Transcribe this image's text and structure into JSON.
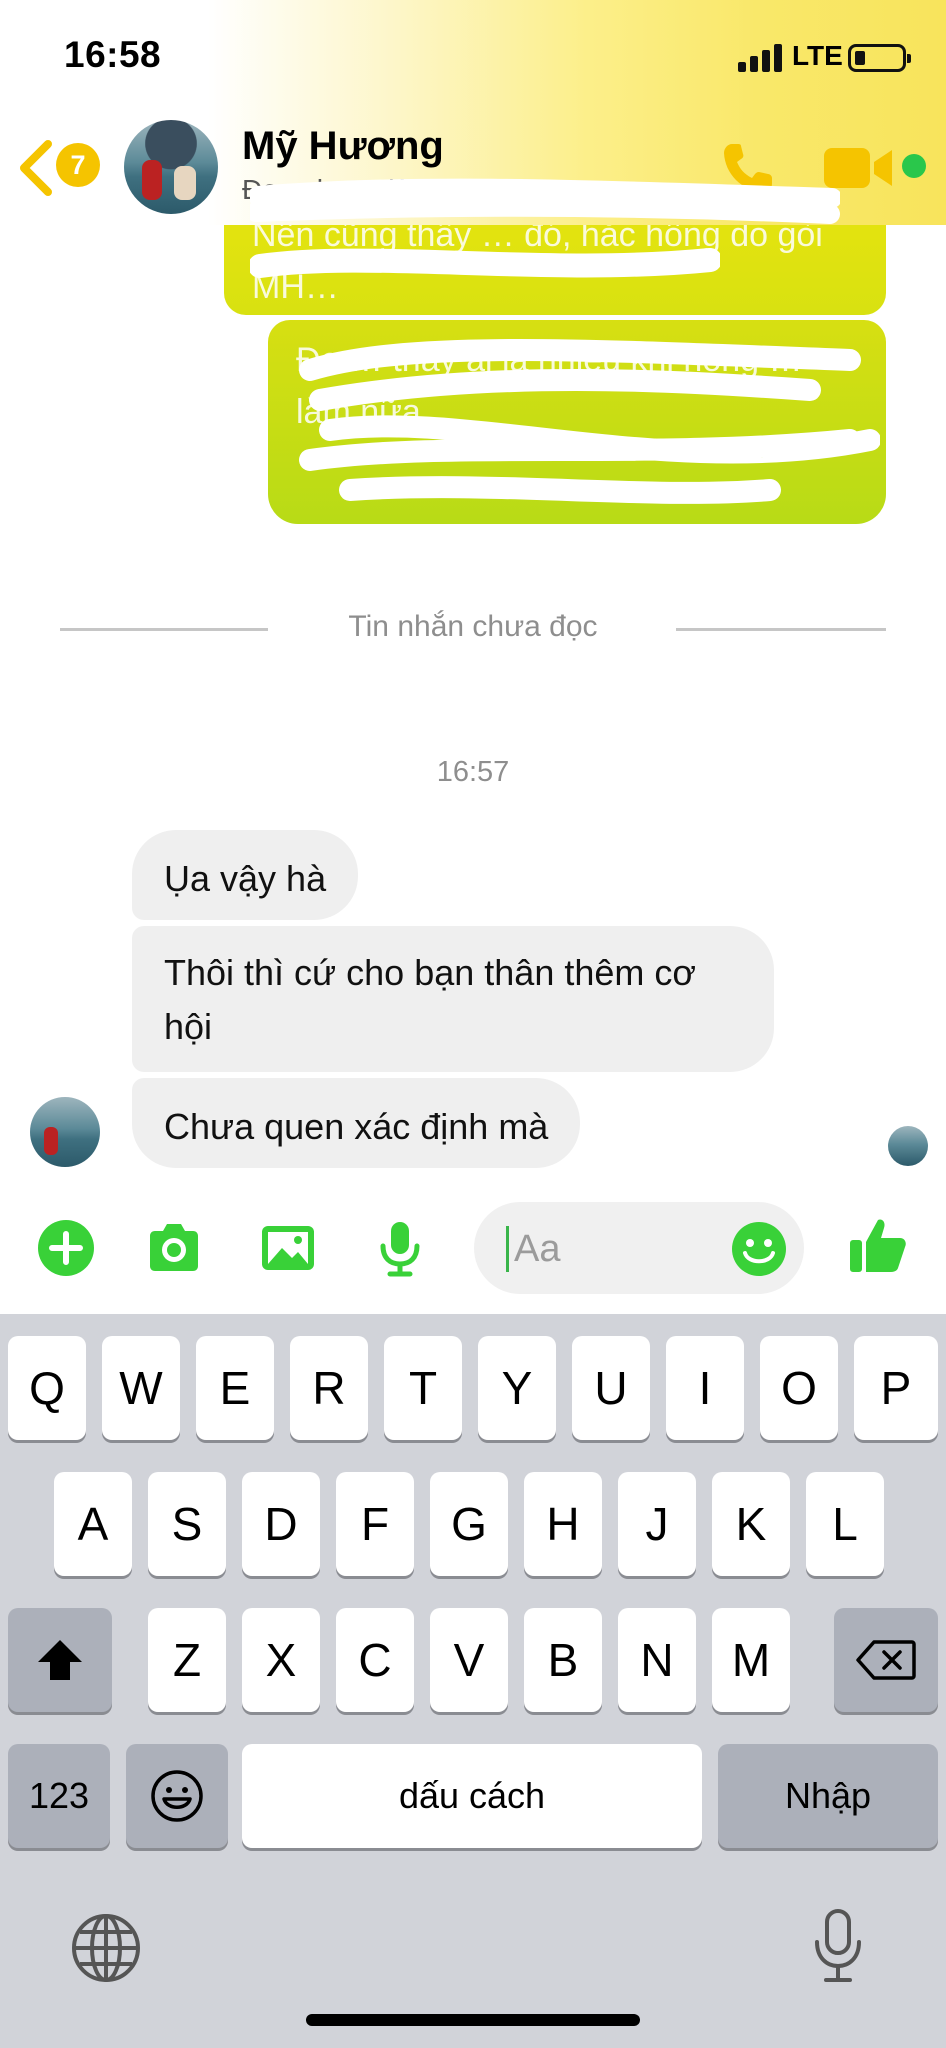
{
  "status_bar": {
    "time": "16:58",
    "network": "LTE"
  },
  "header": {
    "unread_count": "7",
    "contact_name": "Mỹ Hương",
    "contact_status": "Đang hoạt động"
  },
  "sent_messages": [
    {
      "text": "Nên cũng thấy … đó, hắc hông do gòi MH…"
    },
    {
      "text": "Đe … thấy ai la nhiều khi hông … làm nữa"
    }
  ],
  "divider": {
    "label": "Tin nhắn chưa đọc"
  },
  "timestamp": "16:57",
  "received_messages": [
    {
      "text": "Ụa vậy hà"
    },
    {
      "text": "Thôi thì cứ cho bạn thân thêm cơ hội"
    },
    {
      "text": "Chưa quen xác định mà"
    }
  ],
  "composer": {
    "placeholder": "Aa",
    "icons": [
      "plus-icon",
      "camera-icon",
      "image-icon",
      "microphone-icon",
      "emoji-icon",
      "like-icon"
    ]
  },
  "keyboard": {
    "row1": [
      "Q",
      "W",
      "E",
      "R",
      "T",
      "Y",
      "U",
      "I",
      "O",
      "P"
    ],
    "row2": [
      "A",
      "S",
      "D",
      "F",
      "G",
      "H",
      "J",
      "K",
      "L"
    ],
    "row3": [
      "Z",
      "X",
      "C",
      "V",
      "B",
      "N",
      "M"
    ],
    "numbers_label": "123",
    "space_label": "dấu cách",
    "return_label": "Nhập"
  },
  "colors": {
    "accent_green": "#39d138",
    "header_yellow": "#f8e45c",
    "badge_yellow": "#f5c400",
    "online_green": "#2ac74b",
    "sent_bubble_top": "#e7e40e",
    "sent_bubble_bottom": "#b8db16",
    "received_bubble": "#efefef"
  }
}
